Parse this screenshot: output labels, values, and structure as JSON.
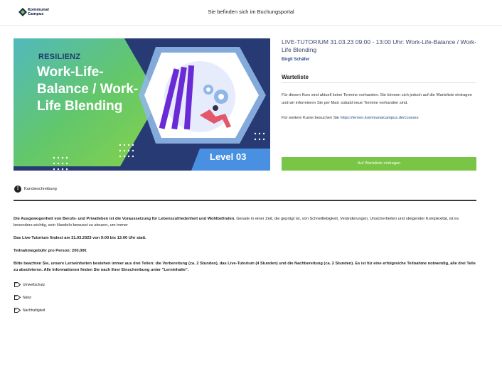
{
  "header": {
    "logo_line1": "Kommunal",
    "logo_line2": "Campus",
    "portal_title": "Sie befinden sich im Buchungsportal"
  },
  "hero": {
    "tag": "RESILIENZ",
    "title": "Work-Life-Balance / Work-Life Blending",
    "level": "Level 03"
  },
  "course": {
    "title": "LIVE-TUTORIUM 31.03.23   09:00 - 13:00 Uhr: Work-Life-Balance / Work-Life Blending",
    "author": "Birgit Schäfer"
  },
  "waitlist": {
    "heading": "Warteliste",
    "info": "Für diesen Kurs sind aktuell keine Termine vorhanden. Sie können sich jedoch auf die Warteliste eintragen und wir informieren Sie per Mail, sobald neue Termine vorhanden sind.",
    "more_prefix": "Für weitere Kurse besuchen Sie",
    "more_link": "https://lernen.kommunalcampus.de/courses",
    "button_label": "Auf Warteliste eintragen"
  },
  "description": {
    "tab_label": "Kursbeschreibung",
    "p1_bold": "Die Ausgewogenheit von Berufs- und Privatleben ist die Voraussetzung für Lebenszufriedenheit und Wohlbefinden.",
    "p1_rest": " Gerade in einer Zeit, die geprägt ist, von Schnelllebigkeit, Veränderungen, Unsicherheiten und steigender Komplexität, ist es besonders wichtig, sein Handeln bewusst zu steuern, um immer",
    "p2": "Das Live-Tutorium findest am 31.03.2023 von 9:00 bis 13:00 Uhr statt.",
    "p3": "Teilnahmegebühr pro Person: 200,00€",
    "p4": "Bitte beachten Sie, unsere Lerneinheiten bestehen immer aus drei Teilen: die Vorbereitung (ca. 2 Stunden), das Live-Tutorium (4 Stunden) und die Nachbereitung (ca. 2 Stunden). Es ist für eine erfolgreiche Teilnahme notwendig, alle drei Teile zu absolvieren. Alle Informationen finden Sie nach Ihrer Einschreibung unter \"Lerninhalte\"."
  },
  "tags": [
    "Umweltschutz",
    "Natur",
    "Nachhaltigkeit"
  ],
  "colors": {
    "accent_green": "#79c546",
    "link_blue": "#274b8a",
    "hero_navy": "#273a73"
  }
}
